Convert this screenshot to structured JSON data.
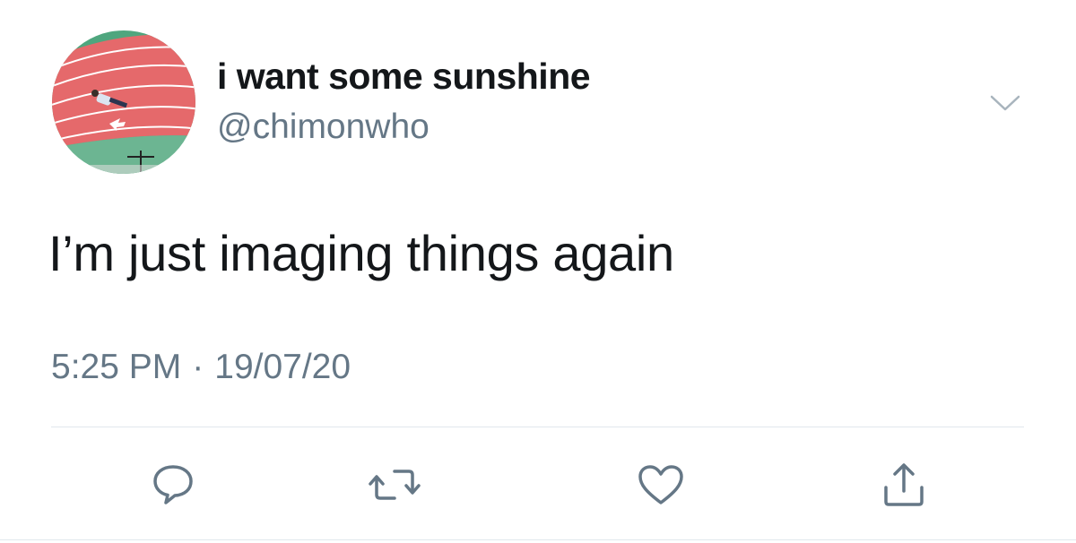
{
  "author": {
    "display_name": "i want some sunshine",
    "handle": "@chimonwho",
    "avatar_icon": "running-track-avatar"
  },
  "tweet": {
    "text": "I’m just imaging things again",
    "time": "5:25 PM",
    "separator": "·",
    "date": "19/07/20"
  },
  "actions": [
    {
      "name": "reply",
      "icon": "speech-bubble-icon"
    },
    {
      "name": "retweet",
      "icon": "retweet-arrows-icon"
    },
    {
      "name": "like",
      "icon": "heart-outline-icon"
    },
    {
      "name": "share",
      "icon": "share-upload-icon"
    }
  ],
  "colors": {
    "text_primary": "#14171a",
    "text_secondary": "#657786",
    "icon_gray": "#657786",
    "divider": "#e1e8ed",
    "track_red": "#e5696b",
    "field_green": "#4fa67e"
  }
}
